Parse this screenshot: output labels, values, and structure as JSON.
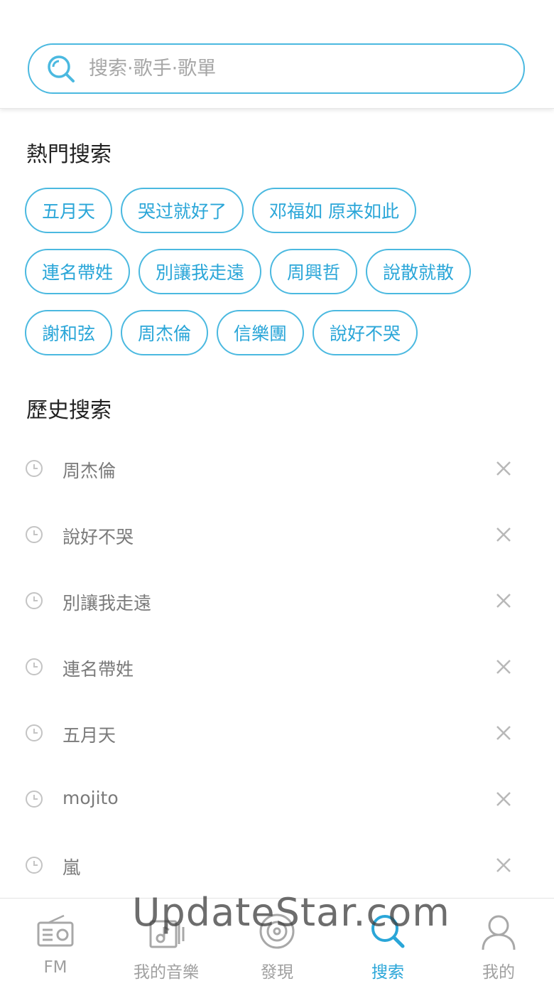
{
  "search": {
    "placeholder": "搜索·歌手·歌單"
  },
  "hot": {
    "title": "熱門搜索",
    "rows": [
      [
        "五月天",
        "哭过就好了",
        "邓福如 原来如此"
      ],
      [
        "連名帶姓",
        "別讓我走遠",
        "周興哲",
        "說散就散"
      ],
      [
        "謝和弦",
        "周杰倫",
        "信樂團",
        "說好不哭"
      ]
    ]
  },
  "history": {
    "title": "歷史搜索",
    "items": [
      "周杰倫",
      "說好不哭",
      "別讓我走遠",
      "連名帶姓",
      "五月天",
      "mojito",
      "嵐"
    ]
  },
  "nav": {
    "items": [
      {
        "label": "FM",
        "icon": "radio-icon",
        "active": false
      },
      {
        "label": "我的音樂",
        "icon": "music-icon",
        "active": false
      },
      {
        "label": "發現",
        "icon": "disc-icon",
        "active": false
      },
      {
        "label": "搜索",
        "icon": "search-icon",
        "active": true
      },
      {
        "label": "我的",
        "icon": "user-icon",
        "active": false
      }
    ]
  },
  "watermark": "UpdateStar.com",
  "colors": {
    "accent": "#2aa6d8",
    "inactive": "#a0a0a0"
  }
}
